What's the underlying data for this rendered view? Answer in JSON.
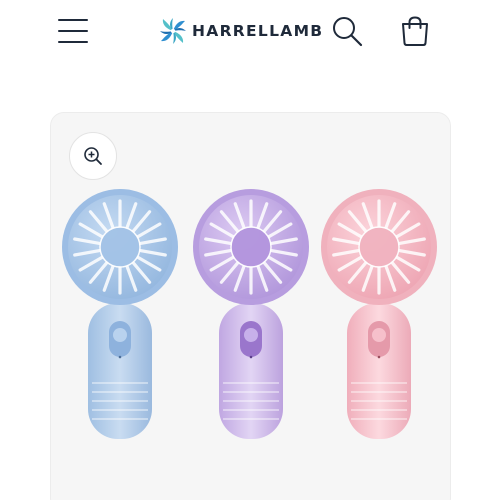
{
  "header": {
    "brand_name": "HARRELLAMB",
    "icons": {
      "menu": "hamburger-menu-icon",
      "logo": "pinwheel-logo-icon",
      "search": "search-icon",
      "cart": "shopping-bag-icon"
    },
    "colors": {
      "icon": "#1f2a3a",
      "logo_blue": "#2f8fd0",
      "logo_teal": "#55c0c9"
    }
  },
  "product": {
    "zoom_icon": "zoom-in-icon",
    "fan_colors": [
      "#aac6e6",
      "#c8b0e6",
      "#f3bcc6"
    ]
  }
}
